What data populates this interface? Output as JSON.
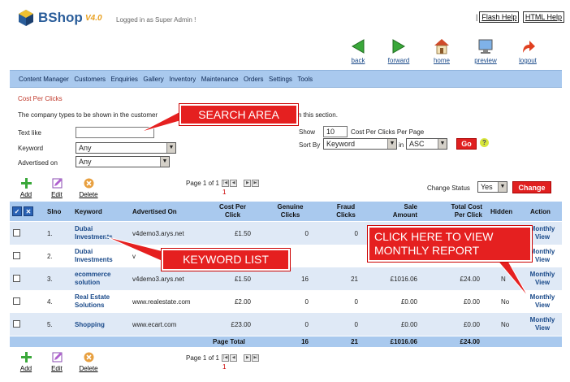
{
  "app": {
    "name": "BShop",
    "version": "V4.0",
    "logged_in": "Logged in as Super Admin !"
  },
  "top_links": {
    "flash_help": "Flash Help",
    "html_help": "HTML Help"
  },
  "nav_buttons": [
    {
      "label": "back",
      "icon": "back-arrow-icon"
    },
    {
      "label": "forward",
      "icon": "forward-arrow-icon"
    },
    {
      "label": "home",
      "icon": "home-icon"
    },
    {
      "label": "preview",
      "icon": "monitor-icon"
    },
    {
      "label": "logout",
      "icon": "logout-arrow-icon"
    }
  ],
  "menu": [
    "Content Manager",
    "Customers",
    "Enquiries",
    "Gallery",
    "Inventory",
    "Maintenance",
    "Orders",
    "Settings",
    "Tools"
  ],
  "breadcrumb": "Cost Per Clicks",
  "description": "The company types to be shown in the customer",
  "description_tail": "n this section.",
  "search": {
    "text_like_label": "Text like",
    "text_like_value": "",
    "keyword_label": "Keyword",
    "keyword_value": "Any",
    "advertised_on_label": "Advertised on",
    "advertised_on_value": "Any",
    "show_label": "Show",
    "show_value": "10",
    "per_page_label": "Cost Per Clicks Per Page",
    "sort_by_label": "Sort By",
    "sort_by_value": "Keyword",
    "in_label": "in",
    "order_value": "ASC",
    "go_label": "Go",
    "help_label": "?"
  },
  "toolbar": {
    "add": "Add",
    "edit": "Edit",
    "delete": "Delete"
  },
  "pager": {
    "text": "Page 1 of 1",
    "current": "1"
  },
  "change_status": {
    "label": "Change Status",
    "value": "Yes",
    "button": "Change"
  },
  "table": {
    "headers": {
      "slno": "Slno",
      "keyword": "Keyword",
      "advertised_on": "Advertised On",
      "cpc1": "Cost Per",
      "cpc2": "Click",
      "genuine1": "Genuine",
      "genuine2": "Clicks",
      "fraud1": "Fraud",
      "fraud2": "Clicks",
      "sale1": "Sale",
      "sale2": "Amount",
      "total1": "Total Cost",
      "total2": "Per Click",
      "hidden": "Hidden",
      "action": "Action"
    },
    "rows": [
      {
        "slno": "1.",
        "kw1": "Dubai",
        "kw2": "Investments",
        "adv": "v4demo3.arys.net",
        "cpc": "£1.50",
        "genuine": "0",
        "fraud": "0",
        "sale": "",
        "total": "",
        "hidden": "",
        "action1": "Monthly",
        "action2": "View"
      },
      {
        "slno": "2.",
        "kw1": "Dubai",
        "kw2": "Investments",
        "adv": "v",
        "cpc": "",
        "genuine": "",
        "fraud": "",
        "sale": "",
        "total": "",
        "hidden": "",
        "action1": "Monthly",
        "action2": "View"
      },
      {
        "slno": "3.",
        "kw1": "ecommerce",
        "kw2": "solution",
        "adv": "v4demo3.arys.net",
        "cpc": "£1.50",
        "genuine": "16",
        "fraud": "21",
        "sale": "£1016.06",
        "total": "£24.00",
        "hidden": "N",
        "action1": "Monthly",
        "action2": "View"
      },
      {
        "slno": "4.",
        "kw1": "Real Estate",
        "kw2": "Solutions",
        "adv": "www.realestate.com",
        "cpc": "£2.00",
        "genuine": "0",
        "fraud": "0",
        "sale": "£0.00",
        "total": "£0.00",
        "hidden": "No",
        "action1": "Monthly",
        "action2": "View"
      },
      {
        "slno": "5.",
        "kw1": "Shopping",
        "kw2": "",
        "adv": "www.ecart.com",
        "cpc": "£23.00",
        "genuine": "0",
        "fraud": "0",
        "sale": "£0.00",
        "total": "£0.00",
        "hidden": "No",
        "action1": "Monthly",
        "action2": "View"
      }
    ],
    "total": {
      "label": "Page Total",
      "genuine": "16",
      "fraud": "21",
      "sale": "£1016.06",
      "total": "£24.00"
    }
  },
  "callouts": {
    "search_area": "SEARCH AREA",
    "keyword_list": "KEYWORD LIST",
    "monthly_line1": "CLICK HERE TO VIEW",
    "monthly_line2": "MONTHLY REPORT"
  },
  "colors": {
    "menu_bar": "#a9c9ee",
    "callout": "#e52020",
    "link": "#1a4a8a"
  }
}
